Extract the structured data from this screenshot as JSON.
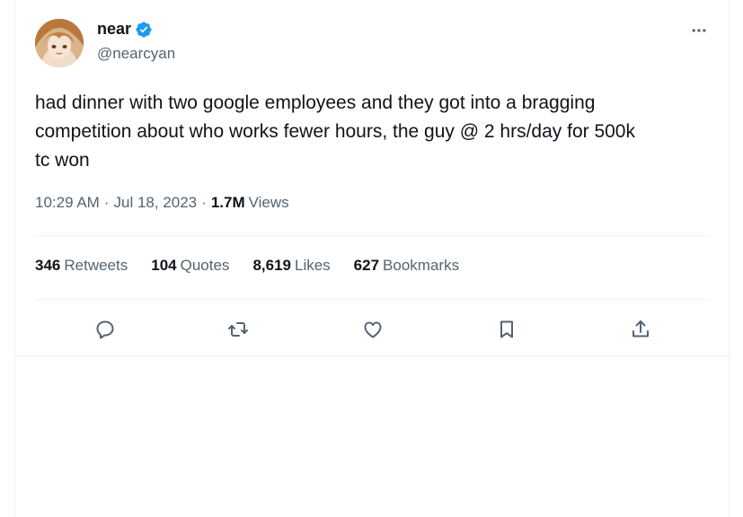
{
  "author": {
    "display_name": "near",
    "handle": "@nearcyan",
    "verified_icon": "verified-badge-icon",
    "accent_color": "#1d9bf0"
  },
  "tweet": {
    "text": "had dinner with two google employees and they got into a bragging\ncompetition about who works fewer hours, the guy @ 2 hrs/day for 500k\ntc won",
    "time": "10:29 AM",
    "date": "Jul 18, 2023",
    "separator": "·",
    "views_count": "1.7M",
    "views_label": "Views"
  },
  "stats": [
    {
      "count": "346",
      "label": "Retweets"
    },
    {
      "count": "104",
      "label": "Quotes"
    },
    {
      "count": "8,619",
      "label": "Likes"
    },
    {
      "count": "627",
      "label": "Bookmarks"
    }
  ],
  "actions": [
    "reply-icon",
    "retweet-icon",
    "like-icon",
    "bookmark-icon",
    "share-icon"
  ],
  "more_icon": "more-options-icon"
}
